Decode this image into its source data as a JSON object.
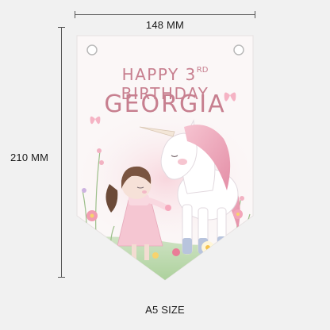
{
  "dimensions": {
    "width_label": "148 MM",
    "height_label": "210 MM",
    "size_label": "A5 SIZE"
  },
  "banner": {
    "line1_prefix": "HAPPY 3",
    "line1_sup": "RD",
    "line1_suffix": " BIRTHDAY",
    "line2": "GEORGIA"
  },
  "colors": {
    "background": "#f1f1f1",
    "text": "#c77f8f",
    "pennant": "#fbf7f7",
    "accent_pink": "#f3b8c6"
  }
}
